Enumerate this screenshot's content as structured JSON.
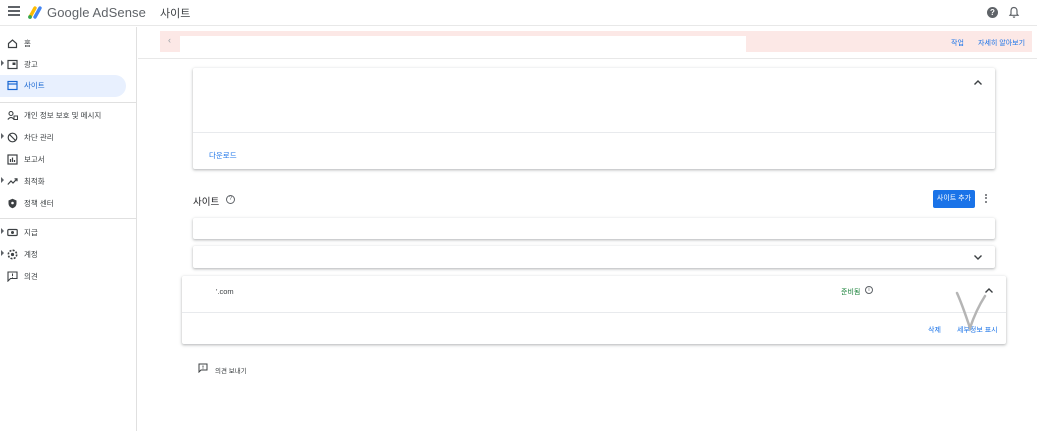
{
  "header": {
    "brand": "Google AdSense",
    "page_title": "사이트",
    "help_icon": "help-icon",
    "notifications_icon": "bell-icon"
  },
  "sidebar": {
    "items": [
      {
        "label": "홈",
        "icon": "home-icon",
        "caret": false,
        "active": false
      },
      {
        "label": "광고",
        "icon": "ads-icon",
        "caret": true,
        "active": false
      },
      {
        "label": "사이트",
        "icon": "sites-icon",
        "caret": false,
        "active": true
      },
      {
        "label": "개인 정보 보호 및 메시지",
        "icon": "privacy-icon",
        "caret": false,
        "active": false
      },
      {
        "label": "차단 관리",
        "icon": "block-icon",
        "caret": true,
        "active": false
      },
      {
        "label": "보고서",
        "icon": "reports-icon",
        "caret": false,
        "active": false
      },
      {
        "label": "최적화",
        "icon": "optimize-icon",
        "caret": true,
        "active": false
      },
      {
        "label": "정책 센터",
        "icon": "policy-icon",
        "caret": false,
        "active": false
      },
      {
        "label": "지급",
        "icon": "payments-icon",
        "caret": true,
        "active": false
      },
      {
        "label": "계정",
        "icon": "account-icon",
        "caret": true,
        "active": false
      },
      {
        "label": "의견",
        "icon": "feedback-icon",
        "caret": false,
        "active": false
      }
    ]
  },
  "banner": {
    "action_primary": "작업",
    "action_secondary": "자세히 알아보기"
  },
  "top_card": {
    "download_label": "다운로드"
  },
  "sites_section": {
    "title": "사이트",
    "add_button": "사이트 추가",
    "site_row": {
      "domain": "'.com",
      "status": "준비됨",
      "delete_label": "삭제",
      "details_label": "세부정보 표시"
    }
  },
  "feedback": {
    "label": "의견 보내기"
  },
  "colors": {
    "accent": "#1a73e8",
    "active_nav_bg": "#e8f0fe",
    "banner_bg": "#fce8e6",
    "status_ready": "#188038"
  }
}
